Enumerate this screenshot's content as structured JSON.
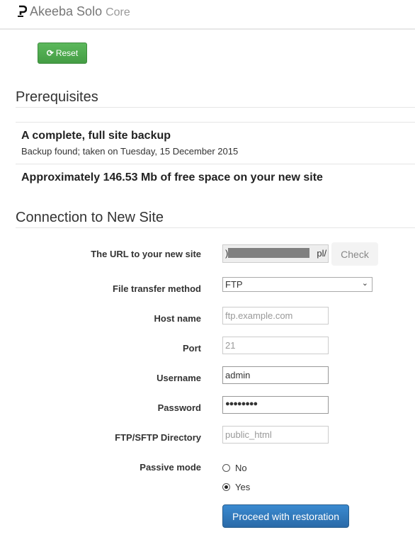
{
  "app": {
    "title": "Akeeba Solo",
    "edition": "Core"
  },
  "toolbar": {
    "reset_label": "Reset"
  },
  "prerequisites": {
    "heading": "Prerequisites",
    "backup_title": "A complete, full site backup",
    "backup_status": "Backup found; taken on Tuesday, 15 December 2015",
    "space": "Approximately 146.53 Mb of free space on your new site"
  },
  "connection": {
    "heading": "Connection to New Site",
    "url_label": "The URL to your new site",
    "url_value_start": ")",
    "url_value_end": "pl/",
    "check_label": "Check",
    "method_label": "File transfer method",
    "method_value": "FTP",
    "host_label": "Host name",
    "host_placeholder": "ftp.example.com",
    "port_label": "Port",
    "port_placeholder": "21",
    "user_label": "Username",
    "user_value": "admin",
    "pass_label": "Password",
    "pass_value": "●●●●●●●●",
    "dir_label": "FTP/SFTP Directory",
    "dir_placeholder": "public_html",
    "passive_label": "Passive mode",
    "passive_no": "No",
    "passive_yes": "Yes",
    "passive_selected": "Yes",
    "proceed_label": "Proceed with restoration"
  },
  "colors": {
    "success": "#5cb85c",
    "primary": "#337ab7"
  }
}
